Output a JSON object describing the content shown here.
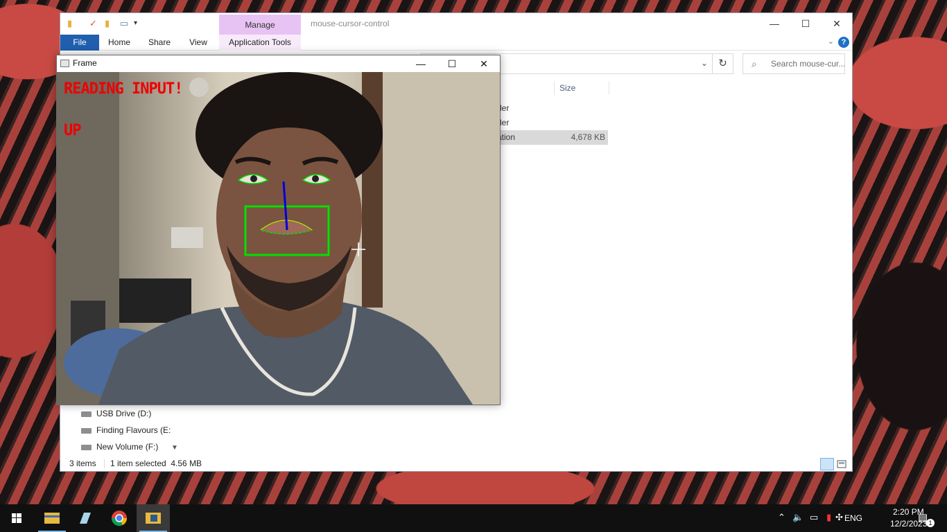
{
  "explorer": {
    "manage_tab": "Manage",
    "title": "mouse-cursor-control",
    "ribbon_tabs": [
      "File",
      "Home",
      "Share",
      "View",
      "Application Tools"
    ],
    "search_placeholder": "Search mouse-cur...",
    "columns": {
      "size": "Size"
    },
    "files": [
      {
        "type": "der",
        "size": ""
      },
      {
        "type": "der",
        "size": ""
      },
      {
        "type": "ation",
        "size": "4,678 KB",
        "selected": true
      }
    ],
    "nav_items": [
      "USB Drive (D:)",
      "Finding Flavours (E:",
      "New Volume (F:)"
    ],
    "status": {
      "items": "3 items",
      "selected": "1 item selected  4.56 MB"
    }
  },
  "frame": {
    "title": "Frame",
    "overlay_status": "READING INPUT!",
    "overlay_direction": "UP",
    "overlay_color": "#ee0000",
    "landmark_color": "#00e000",
    "nose_line_color": "#0000dd"
  },
  "taskbar": {
    "apps": [
      "start-icon",
      "file-explorer-icon",
      "notepad-icon",
      "chrome-icon",
      "python-icon"
    ],
    "language": "ENG",
    "time": "2:20 PM",
    "date": "12/2/2023",
    "notification_count": "1"
  }
}
